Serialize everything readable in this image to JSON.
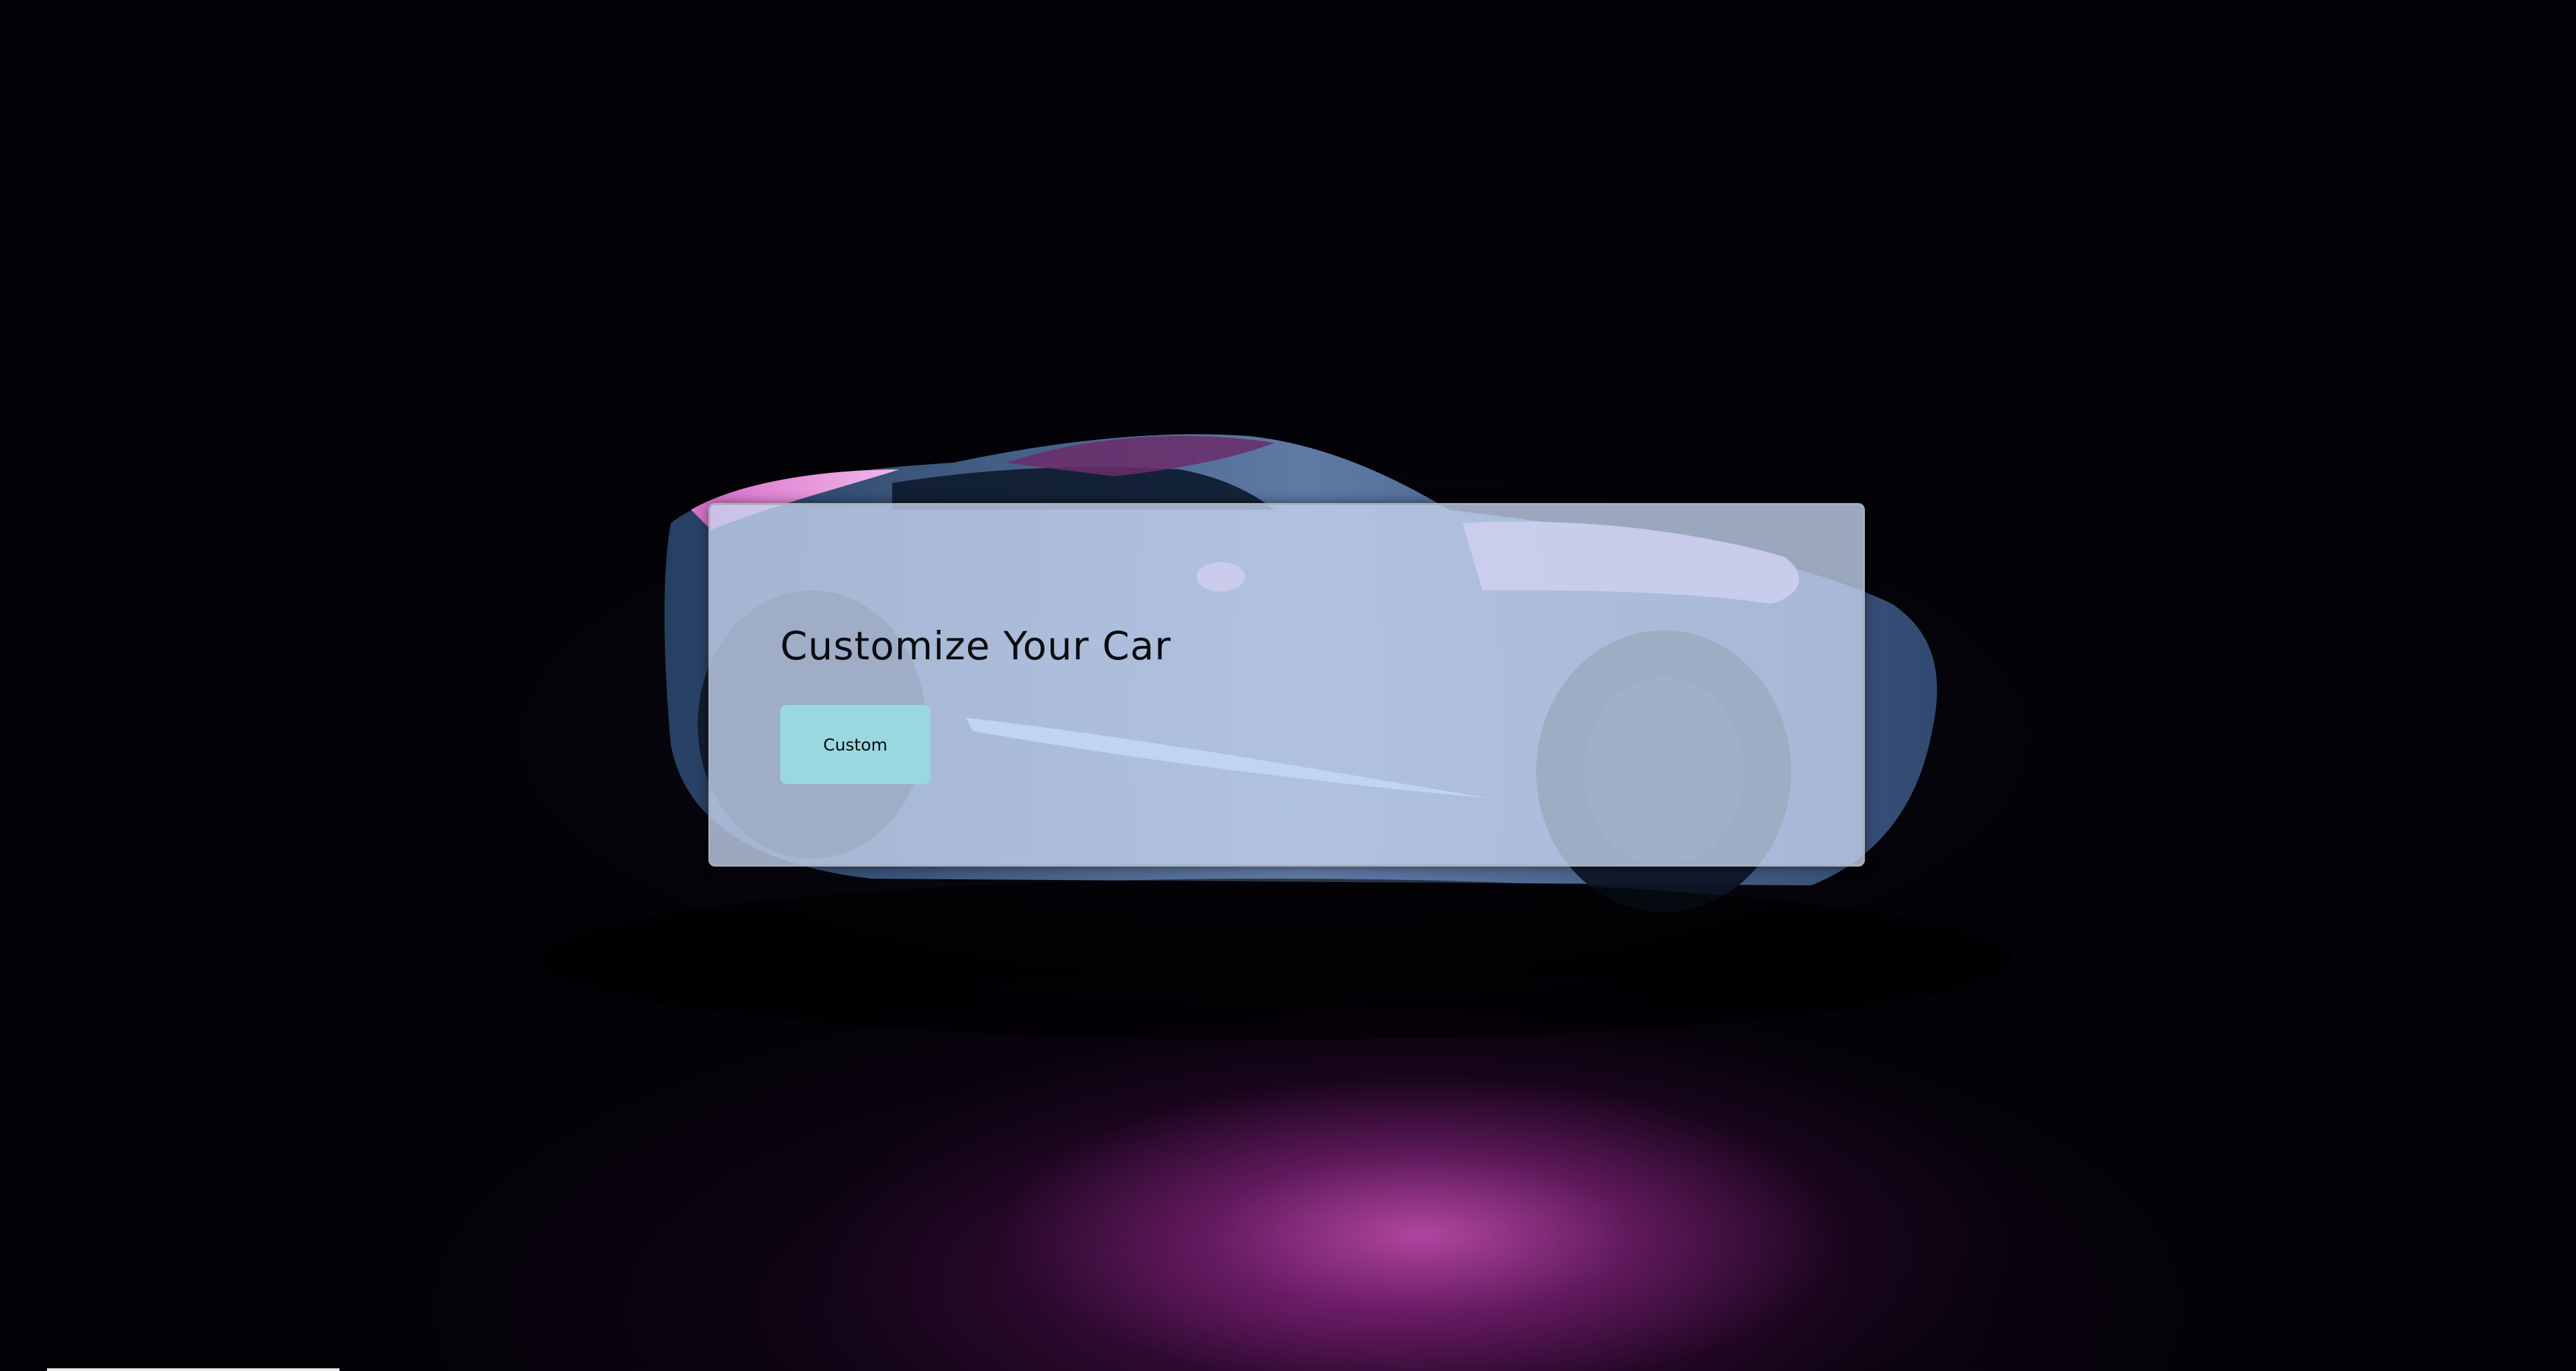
{
  "page": {
    "title": "Customize Your Car",
    "button_label": "Custom"
  },
  "background": {
    "description_icon": "sports-car-photo",
    "accent_color": "#c64fb4"
  },
  "colors": {
    "panel_bg": "#c6d6f0",
    "button_bg": "#9ad8e0",
    "text": "#0b0b10"
  }
}
